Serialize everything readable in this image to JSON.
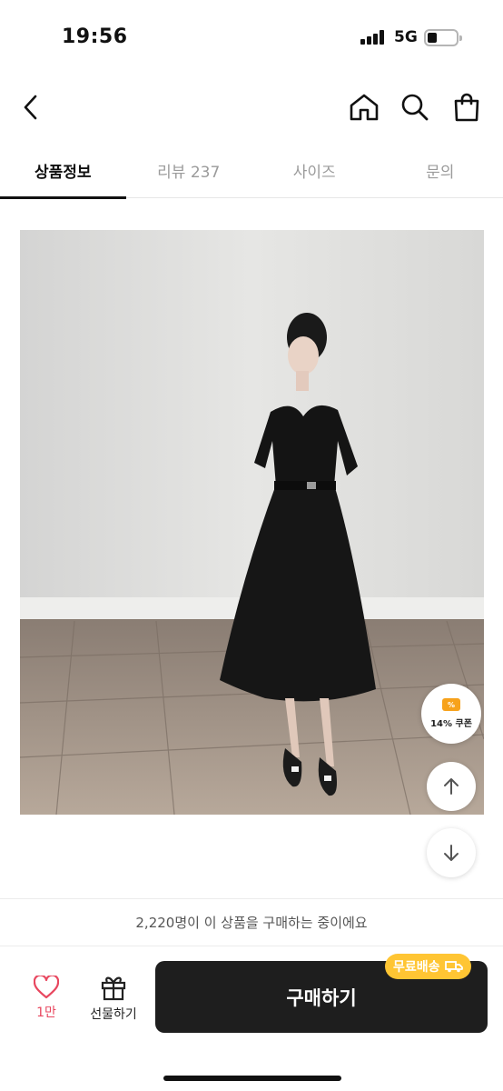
{
  "status_bar": {
    "time": "19:56",
    "network": "5G"
  },
  "header": {
    "back_icon": "chevron-left-icon",
    "home_icon": "home-icon",
    "search_icon": "search-icon",
    "bag_icon": "shopping-bag-icon"
  },
  "tabs": [
    {
      "label": "상품정보",
      "active": true
    },
    {
      "label": "리뷰 237",
      "active": false
    },
    {
      "label": "사이즈",
      "active": false
    },
    {
      "label": "문의",
      "active": false
    }
  ],
  "floating": {
    "coupon_label": "14% 쿠폰",
    "coupon_icon_text": "%"
  },
  "notice": {
    "text": "2,220명이 이 상품을 구매하는 중이에요"
  },
  "bottom_bar": {
    "like_count": "1만",
    "gift_label": "선물하기",
    "buy_label": "구매하기",
    "shipping_badge": "무료배송"
  },
  "colors": {
    "accent": "#ffc533",
    "like": "#e8475f",
    "buy_button": "#1e1e1e"
  }
}
